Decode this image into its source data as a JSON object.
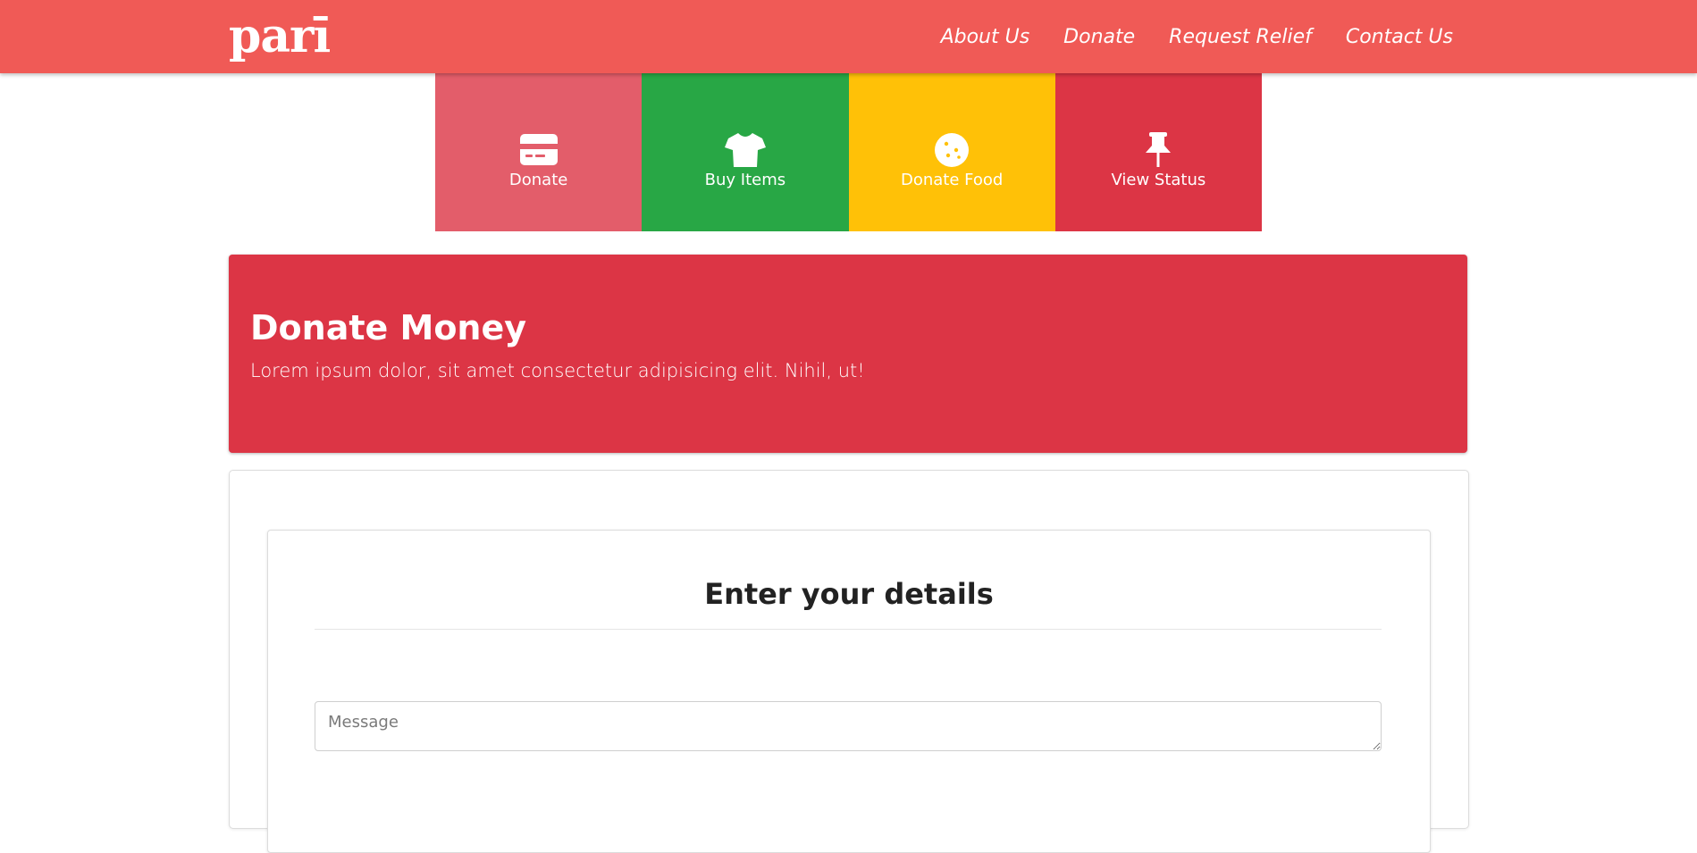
{
  "brand": {
    "logo_text": "parī",
    "color": "#f05a56"
  },
  "nav": {
    "links": [
      "About Us",
      "Donate",
      "Request Relief",
      "Contact Us"
    ]
  },
  "tiles": [
    {
      "label": "Donate",
      "icon": "credit-card-icon",
      "color": "#e35d6a"
    },
    {
      "label": "Buy Items",
      "icon": "tshirt-icon",
      "color": "#28a745"
    },
    {
      "label": "Donate Food",
      "icon": "cookie-icon",
      "color": "#ffc107"
    },
    {
      "label": "View Status",
      "icon": "pushpin-icon",
      "color": "#dc3545"
    }
  ],
  "banner": {
    "title": "Donate Money",
    "subtitle": "Lorem ipsum dolor, sit amet consectetur adipisicing elit. Nihil, ut!",
    "color": "#dc3545"
  },
  "form": {
    "title": "Enter your details",
    "message_placeholder": "Message",
    "message_value": ""
  }
}
